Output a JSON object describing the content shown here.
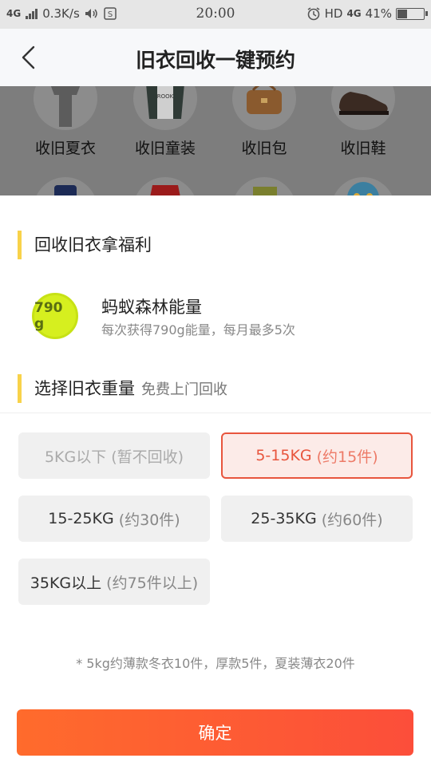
{
  "status_bar": {
    "network": "4G",
    "speed": "0.3K/s",
    "time": "20:00",
    "hd": "HD",
    "network_right": "4G",
    "battery": "41%",
    "battery_level": 0.41
  },
  "nav": {
    "title": "旧衣回收一键预约"
  },
  "categories": [
    {
      "label": "收旧夏衣",
      "icon": "tshirt-icon"
    },
    {
      "label": "收旧童装",
      "icon": "kids-jacket-icon"
    },
    {
      "label": "收旧包",
      "icon": "bag-icon"
    },
    {
      "label": "收旧鞋",
      "icon": "shoe-icon"
    }
  ],
  "benefits": {
    "title": "回收旧衣拿福利",
    "badge": "790 g",
    "name": "蚂蚁森林能量",
    "desc": "每次获得790g能量，每月最多5次"
  },
  "weight": {
    "title": "选择旧衣重量",
    "subtitle": "免费上门回收",
    "options": [
      {
        "main": "5KG以下",
        "hint": "(暂不回收)",
        "state": "disabled"
      },
      {
        "main": "5-15KG",
        "hint": "(约15件)",
        "state": "selected"
      },
      {
        "main": "15-25KG",
        "hint": "(约30件)",
        "state": "normal"
      },
      {
        "main": "25-35KG",
        "hint": "(约60件)",
        "state": "normal"
      },
      {
        "main": "35KG以上",
        "hint": "(约75件以上)",
        "state": "normal"
      }
    ],
    "note": "* 5kg约薄款冬衣10件，厚款5件，夏装薄衣20件"
  },
  "confirm_label": "确定",
  "colors": {
    "accent": "#fc4e3a",
    "accent_start": "#ff6b2c",
    "section_bar": "#f8d24a",
    "badge": "#d6ef1f"
  }
}
